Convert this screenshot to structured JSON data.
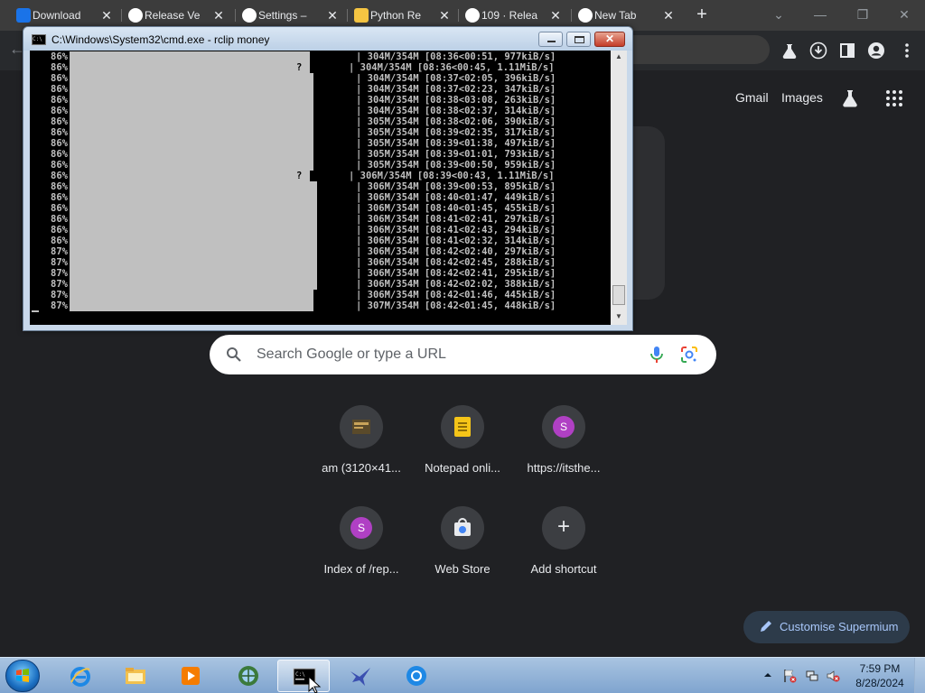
{
  "browser": {
    "tabs": [
      {
        "label": "Download",
        "icon": "page-icon",
        "color": "#1a73e8"
      },
      {
        "label": "Release Ve",
        "icon": "github-icon",
        "color": "#ffffff"
      },
      {
        "label": "Settings –",
        "icon": "gear-icon",
        "color": "#ffffff"
      },
      {
        "label": "Python Re",
        "icon": "python-icon",
        "color": "#f5c542"
      },
      {
        "label": "109 · Relea",
        "icon": "github-icon",
        "color": "#ffffff"
      },
      {
        "label": "New Tab",
        "icon": "chrome-icon",
        "color": "#ffffff"
      }
    ],
    "new_tab_symbol": "+",
    "close_symbol": "✕",
    "window_controls": {
      "dropdown": "⌄",
      "minimize": "—",
      "restore": "❐",
      "close": "✕"
    }
  },
  "ntp": {
    "gmail": "Gmail",
    "images": "Images",
    "search_placeholder": "Search Google or type a URL",
    "shortcuts": [
      {
        "label": "am (3120×41...",
        "icon": "image-thumbnail-icon"
      },
      {
        "label": "Notepad onli...",
        "icon": "notepad-icon"
      },
      {
        "label": "https://itsthe...",
        "icon": "letter-s-icon",
        "letter": "S"
      },
      {
        "label": "Index of /rep...",
        "icon": "letter-s-icon",
        "letter": "S"
      },
      {
        "label": "Web Store",
        "icon": "web-store-icon"
      },
      {
        "label": "Add shortcut",
        "icon": "plus-icon",
        "symbol": "+"
      }
    ],
    "customise_label": "Customise Supermium"
  },
  "cmd": {
    "title": "C:\\Windows\\System32\\cmd.exe - rclip  money",
    "rows": [
      {
        "pct": "86%",
        "bar": 266,
        "q": "?",
        "qpos": 302,
        "inv": false,
        "stat": "| 304M/354M [08:36<00:51, 977kiB/s]"
      },
      {
        "pct": "86%",
        "bar": 266,
        "q": "?",
        "qpos": 294,
        "inv": true,
        "stat": "| 304M/354M [08:36<00:45, 1.11MiB/s]"
      },
      {
        "pct": "86%",
        "bar": 270,
        "q": "?",
        "qpos": 302,
        "inv": false,
        "stat": "| 304M/354M [08:37<02:05, 396kiB/s]"
      },
      {
        "pct": "86%",
        "bar": 270,
        "q": "?",
        "qpos": 302,
        "inv": false,
        "stat": "| 304M/354M [08:37<02:23, 347kiB/s]"
      },
      {
        "pct": "86%",
        "bar": 270,
        "q": "?",
        "qpos": 302,
        "inv": false,
        "stat": "| 304M/354M [08:38<03:08, 263kiB/s]"
      },
      {
        "pct": "86%",
        "bar": 270,
        "q": "?",
        "qpos": 302,
        "inv": false,
        "stat": "| 304M/354M [08:38<02:37, 314kiB/s]"
      },
      {
        "pct": "86%",
        "bar": 270,
        "q": "?",
        "qpos": 302,
        "inv": false,
        "stat": "| 305M/354M [08:38<02:06, 390kiB/s]"
      },
      {
        "pct": "86%",
        "bar": 270,
        "q": "?",
        "qpos": 302,
        "inv": false,
        "stat": "| 305M/354M [08:39<02:35, 317kiB/s]"
      },
      {
        "pct": "86%",
        "bar": 270,
        "q": "?",
        "qpos": 302,
        "inv": false,
        "stat": "| 305M/354M [08:39<01:38, 497kiB/s]"
      },
      {
        "pct": "86%",
        "bar": 270,
        "q": "?",
        "qpos": 302,
        "inv": false,
        "stat": "| 305M/354M [08:39<01:01, 793kiB/s]"
      },
      {
        "pct": "86%",
        "bar": 270,
        "q": "?",
        "qpos": 302,
        "inv": false,
        "stat": "| 305M/354M [08:39<00:50, 959kiB/s]"
      },
      {
        "pct": "86%",
        "bar": 266,
        "q": "?",
        "qpos": 294,
        "inv": true,
        "stat": "| 306M/354M [08:39<00:43, 1.11MiB/s]"
      },
      {
        "pct": "86%",
        "bar": 274,
        "q": "",
        "qpos": 302,
        "inv": false,
        "stat": "| 306M/354M [08:39<00:53, 895kiB/s]"
      },
      {
        "pct": "86%",
        "bar": 274,
        "q": "",
        "qpos": 302,
        "inv": false,
        "stat": "| 306M/354M [08:40<01:47, 449kiB/s]"
      },
      {
        "pct": "86%",
        "bar": 274,
        "q": "",
        "qpos": 302,
        "inv": false,
        "stat": "| 306M/354M [08:40<01:45, 455kiB/s]"
      },
      {
        "pct": "86%",
        "bar": 274,
        "q": "",
        "qpos": 302,
        "inv": false,
        "stat": "| 306M/354M [08:41<02:41, 297kiB/s]"
      },
      {
        "pct": "86%",
        "bar": 274,
        "q": "",
        "qpos": 302,
        "inv": false,
        "stat": "| 306M/354M [08:41<02:43, 294kiB/s]"
      },
      {
        "pct": "86%",
        "bar": 274,
        "q": "",
        "qpos": 302,
        "inv": false,
        "stat": "| 306M/354M [08:41<02:32, 314kiB/s]"
      },
      {
        "pct": "87%",
        "bar": 274,
        "q": "",
        "qpos": 302,
        "inv": false,
        "stat": "| 306M/354M [08:42<02:40, 297kiB/s]"
      },
      {
        "pct": "87%",
        "bar": 274,
        "q": "",
        "qpos": 302,
        "inv": false,
        "stat": "| 306M/354M [08:42<02:45, 288kiB/s]"
      },
      {
        "pct": "87%",
        "bar": 274,
        "q": "",
        "qpos": 302,
        "inv": false,
        "stat": "| 306M/354M [08:42<02:41, 295kiB/s]"
      },
      {
        "pct": "87%",
        "bar": 274,
        "q": "",
        "qpos": 302,
        "inv": false,
        "stat": "| 306M/354M [08:42<02:02, 388kiB/s]"
      },
      {
        "pct": "87%",
        "bar": 270,
        "q": "?",
        "qpos": 302,
        "inv": false,
        "stat": "| 306M/354M [08:42<01:46, 445kiB/s]"
      },
      {
        "pct": "87%",
        "bar": 270,
        "q": "?",
        "qpos": 302,
        "inv": false,
        "stat": "| 307M/354M [08:42<01:45, 448kiB/s]"
      }
    ]
  },
  "taskbar": {
    "apps": [
      {
        "name": "internet-explorer-icon",
        "active": false
      },
      {
        "name": "file-explorer-icon",
        "active": false
      },
      {
        "name": "media-player-icon",
        "active": false
      },
      {
        "name": "globe-app-icon",
        "active": false
      },
      {
        "name": "command-prompt-icon",
        "active": true
      },
      {
        "name": "bird-app-icon",
        "active": false
      },
      {
        "name": "chromium-browser-icon",
        "active": false
      }
    ],
    "time": "7:59 PM",
    "date": "8/28/2024"
  },
  "colors": {
    "ntp_bg": "#202124",
    "accent": "#a8c7fa",
    "console_text": "#c0c0c0"
  }
}
